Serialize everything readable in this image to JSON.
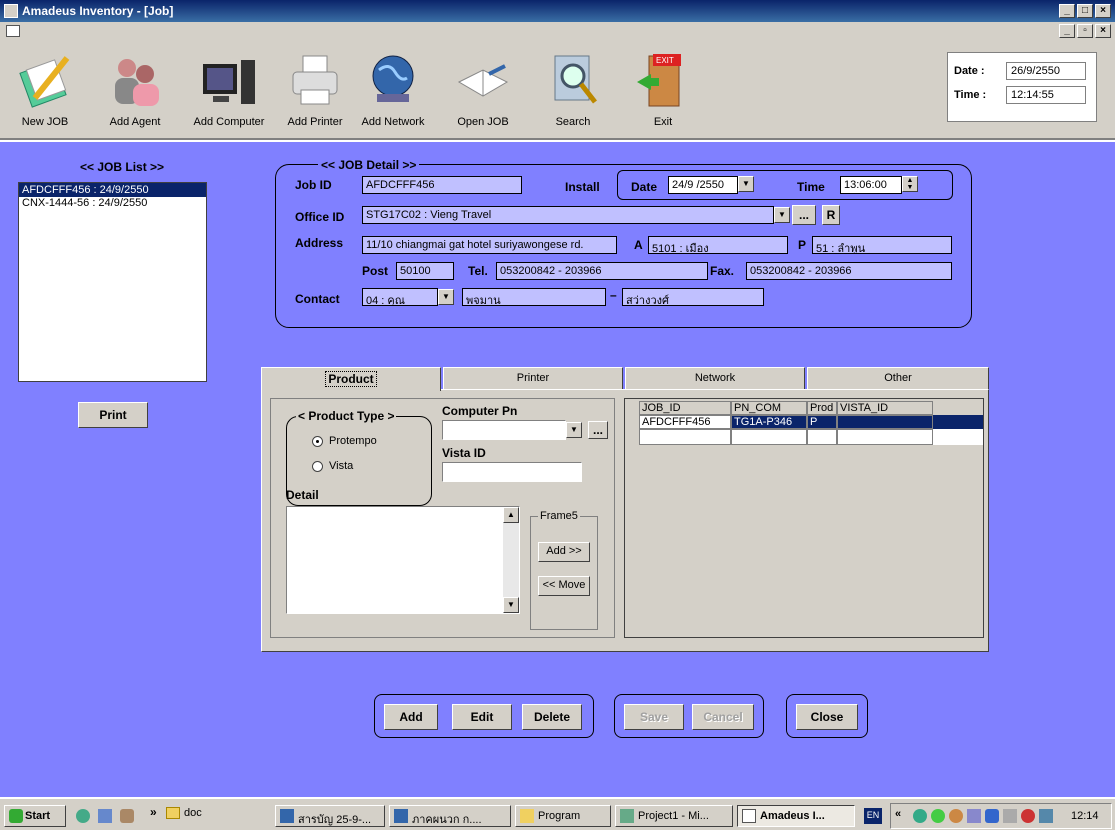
{
  "window": {
    "title": "Amadeus Inventory - [Job]"
  },
  "toolbar": {
    "items": [
      {
        "label": "New JOB"
      },
      {
        "label": "Add Agent"
      },
      {
        "label": "Add Computer"
      },
      {
        "label": "Add Printer"
      },
      {
        "label": "Add Network"
      },
      {
        "label": "Open JOB"
      },
      {
        "label": "Search"
      },
      {
        "label": "Exit"
      }
    ],
    "exit_sign": "EXIT"
  },
  "datetime": {
    "date_label": "Date :",
    "date_value": "26/9/2550",
    "time_label": "Time :",
    "time_value": "12:14:55"
  },
  "job_list": {
    "title": "<< JOB List >>",
    "items": [
      "AFDCFFF456 : 24/9/2550",
      "CNX-1444-56 : 24/9/2550"
    ],
    "print_label": "Print"
  },
  "job_detail": {
    "title": "<< JOB Detail >>",
    "job_id_label": "Job ID",
    "job_id": "AFDCFFF456",
    "install_label": "Install",
    "date_label": "Date",
    "date_value": "24/9 /2550",
    "time_label": "Time",
    "time_value": "13:06:00",
    "office_id_label": "Office ID",
    "office_id": "STG17C02 : Vieng Travel",
    "office_btn": "...",
    "r_btn": "R",
    "address_label": "Address",
    "address": "11/10 chiangmai gat hotel suriyawongese rd.",
    "a_label": "A",
    "a_value": "5101 : เมือง",
    "p_label": "P",
    "p_value": "51 : ลำพูน",
    "post_label": "Post",
    "post_value": "50100",
    "tel_label": "Tel.",
    "tel_value": "053200842 - 203966",
    "fax_label": "Fax.",
    "fax_value": "053200842 - 203966",
    "contact_label": "Contact",
    "contact_title": "04 : คุณ",
    "contact_first": "พจมาน",
    "contact_dash": "–",
    "contact_last": "สว่างวงศ์"
  },
  "tabs": [
    "Product",
    "Printer",
    "Network",
    "Other"
  ],
  "product": {
    "type_title": "< Product Type >",
    "radio1": "Protempo",
    "radio2": "Vista",
    "computer_pn_label": "Computer Pn",
    "computer_pn_btn": "...",
    "vista_id_label": "Vista ID",
    "detail_label": "Detail",
    "frame_label": "Frame5",
    "add_btn": "Add >>",
    "move_btn": "<< Move"
  },
  "grid": {
    "columns": [
      "JOB_ID",
      "PN_COM",
      "Prod",
      "VISTA_ID"
    ],
    "rows": [
      [
        "AFDCFFF456",
        "TG1A-P346",
        "P",
        ""
      ],
      [
        "",
        "",
        "",
        ""
      ]
    ]
  },
  "actions": {
    "add": "Add",
    "edit": "Edit",
    "delete": "Delete",
    "save": "Save",
    "cancel": "Cancel",
    "close": "Close"
  },
  "taskbar": {
    "start": "Start",
    "chevron": "»",
    "items": [
      "doc",
      "สารบัญ 25-9-...",
      "ภาคผนวก ก....",
      "Program",
      "Project1 - Mi...",
      "Amadeus I..."
    ],
    "lang": "EN",
    "tray_chevron": "«",
    "clock": "12:14"
  }
}
